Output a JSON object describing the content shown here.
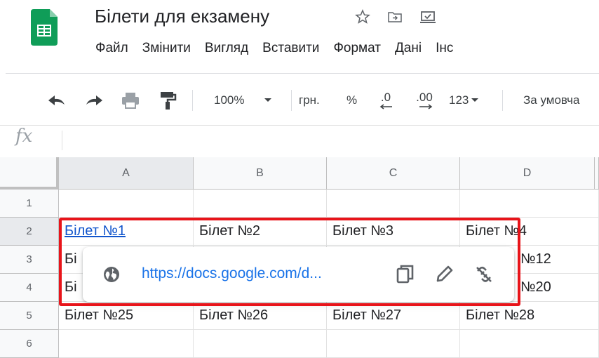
{
  "app": {
    "doc_title": "Білети для екзамену",
    "menu": [
      "Файл",
      "Змінити",
      "Вигляд",
      "Вставити",
      "Формат",
      "Дані",
      "Інс"
    ]
  },
  "toolbar": {
    "zoom": "100%",
    "currency": "грн.",
    "percent": "%",
    "dec_less": ".0",
    "dec_more": ".00",
    "more_formats": "123",
    "font": "За умовча"
  },
  "formula_bar": {
    "fx_label": "fx"
  },
  "grid": {
    "columns": [
      "A",
      "B",
      "C",
      "D"
    ],
    "rows": [
      "1",
      "2",
      "3",
      "4",
      "5",
      "6"
    ],
    "cells": {
      "r2": [
        "Білет №1",
        "Білет №2",
        "Білет №3",
        "Білет №4"
      ],
      "r3a": "Бі",
      "r3d": "№12",
      "r4a": "Бі",
      "r4d": "№20",
      "r5": [
        "Білет №25",
        "Білет №26",
        "Білет №27",
        "Білет №28"
      ]
    }
  },
  "link_popup": {
    "url": "https://docs.google.com/d...",
    "icons": [
      "globe-icon",
      "copy-icon",
      "edit-icon",
      "unlink-icon"
    ]
  },
  "colors": {
    "highlight": "#e8141a",
    "link": "#1a73e8",
    "sheets_green": "#0f9d58"
  }
}
